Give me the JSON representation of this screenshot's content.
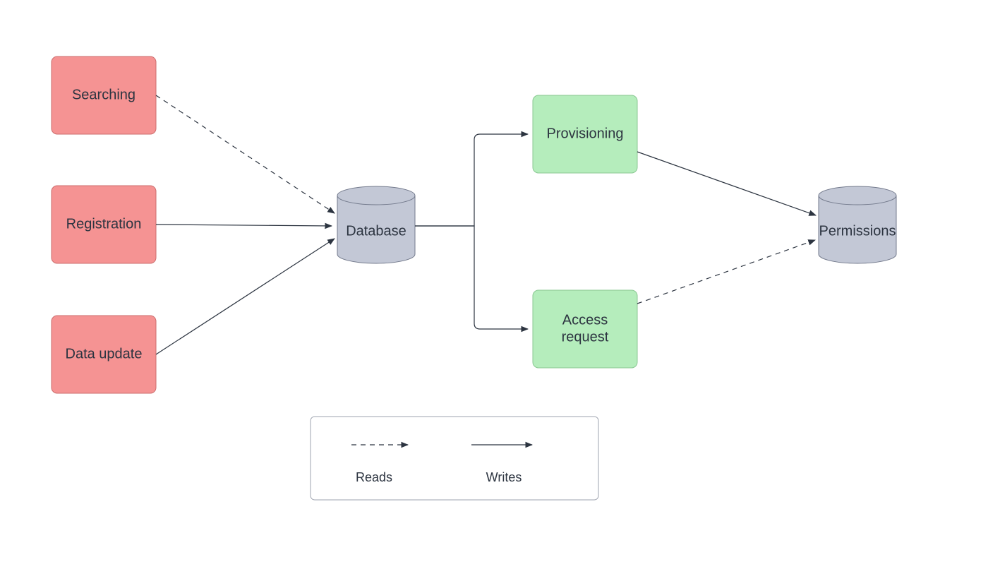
{
  "nodes": {
    "searching": "Searching",
    "registration": "Registration",
    "data_update": "Data update",
    "database": "Database",
    "provisioning": "Provisioning",
    "access_request_l1": "Access",
    "access_request_l2": "request",
    "permissions": "Permissions"
  },
  "legend": {
    "reads": "Reads",
    "writes": "Writes"
  },
  "edges": [
    {
      "from": "searching",
      "to": "database",
      "style": "dashed"
    },
    {
      "from": "registration",
      "to": "database",
      "style": "solid"
    },
    {
      "from": "data_update",
      "to": "database",
      "style": "solid"
    },
    {
      "from": "database",
      "to": "provisioning",
      "style": "solid"
    },
    {
      "from": "database",
      "to": "access_request",
      "style": "solid"
    },
    {
      "from": "provisioning",
      "to": "permissions",
      "style": "solid"
    },
    {
      "from": "access_request",
      "to": "permissions",
      "style": "dashed"
    }
  ],
  "colors": {
    "red_fill": "#f59393",
    "red_stroke": "#cc6e6e",
    "green_fill": "#b5edbc",
    "green_stroke": "#8ac892",
    "cylinder_fill": "#c3c8d6",
    "cylinder_stroke": "#737a8c",
    "text": "#2c3440"
  }
}
